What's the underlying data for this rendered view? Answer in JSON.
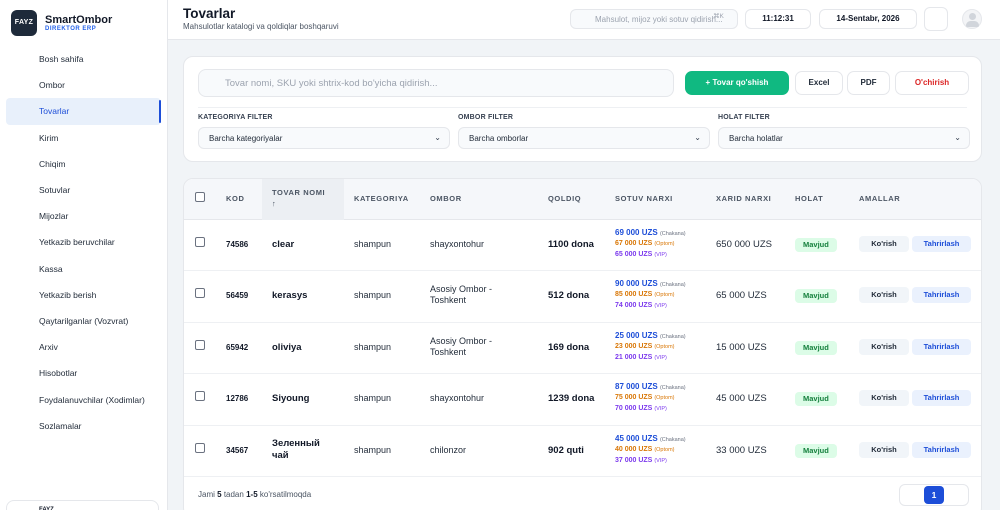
{
  "brand": {
    "logo": "FAYZ",
    "name": "SmartOmbor",
    "subtitle": "DIREKTOR ERP"
  },
  "sidebar": {
    "items": [
      {
        "label": "Bosh sahifa"
      },
      {
        "label": "Ombor"
      },
      {
        "label": "Tovarlar",
        "active": true
      },
      {
        "label": "Kirim"
      },
      {
        "label": "Chiqim"
      },
      {
        "label": "Sotuvlar"
      },
      {
        "label": "Mijozlar"
      },
      {
        "label": "Yetkazib beruvchilar"
      },
      {
        "label": "Kassa"
      },
      {
        "label": "Yetkazib berish"
      },
      {
        "label": "Qaytarilganlar (Vozvrat)"
      },
      {
        "label": "Arxiv"
      },
      {
        "label": "Hisobotlar"
      },
      {
        "label": "Foydalanuvchilar (Xodimlar)"
      },
      {
        "label": "Sozlamalar"
      }
    ],
    "user_card": "FAYZ"
  },
  "header": {
    "title": "Tovarlar",
    "subtitle": "Mahsulotlar katalogi va qoldiqlar boshqaruvi",
    "search_placeholder": "Mahsulot, mijoz yoki sotuv qidirish...",
    "shortcut": "⌘K",
    "clock": "11:12:31",
    "date": "14-Sentabr, 2026"
  },
  "toolbar": {
    "search_placeholder": "Tovar nomi, SKU yoki shtrix-kod bo'yicha qidirish...",
    "add_label": "+ Tovar qo'shish",
    "excel_label": "Excel",
    "pdf_label": "PDF",
    "delete_label": "O'chirish"
  },
  "filters": {
    "category": {
      "label": "KATEGORIYA FILTER",
      "value": "Barcha kategoriyalar"
    },
    "warehouse": {
      "label": "OMBOR FILTER",
      "value": "Barcha omborlar"
    },
    "status": {
      "label": "HOLAT FILTER",
      "value": "Barcha holatlar"
    }
  },
  "table": {
    "columns": {
      "kod": "KOD",
      "name": "TOVAR NOMI",
      "name_sort": "↑",
      "category": "KATEGORIYA",
      "warehouse": "OMBOR",
      "stock": "QOLDIQ",
      "sell_price": "SOTUV NARXI",
      "buy_price": "XARID NARXI",
      "status": "HOLAT",
      "actions": "AMALLAR"
    },
    "price_tags": {
      "retail": "(Chakana)",
      "wholesale": "(Optom)",
      "vip": "(VIP)"
    },
    "view_label": "Ko'rish",
    "edit_label": "Tahrirlash",
    "rows": [
      {
        "kod": "74586",
        "name": "clear",
        "category": "shampun",
        "warehouse": "shayxontohur",
        "stock": "1100 dona",
        "retail": "69 000 UZS",
        "wholesale": "67 000 UZS",
        "vip": "65 000 UZS",
        "buy": "650 000 UZS",
        "status": "Mavjud"
      },
      {
        "kod": "56459",
        "name": "kerasys",
        "category": "shampun",
        "warehouse": "Asosiy Ombor - Toshkent",
        "stock": "512 dona",
        "retail": "90 000 UZS",
        "wholesale": "85 000 UZS",
        "vip": "74 000 UZS",
        "buy": "65 000 UZS",
        "status": "Mavjud"
      },
      {
        "kod": "65942",
        "name": "oliviya",
        "category": "shampun",
        "warehouse": "Asosiy Ombor - Toshkent",
        "stock": "169 dona",
        "retail": "25 000 UZS",
        "wholesale": "23 000 UZS",
        "vip": "21 000 UZS",
        "buy": "15 000 UZS",
        "status": "Mavjud"
      },
      {
        "kod": "12786",
        "name": "Siyoung",
        "category": "shampun",
        "warehouse": "shayxontohur",
        "stock": "1239 dona",
        "retail": "87 000 UZS",
        "wholesale": "75 000 UZS",
        "vip": "70 000 UZS",
        "buy": "45 000 UZS",
        "status": "Mavjud"
      },
      {
        "kod": "34567",
        "name": "Зеленный чай",
        "category": "shampun",
        "warehouse": "chilonzor",
        "stock": "902 quti",
        "retail": "45 000 UZS",
        "wholesale": "40 000 UZS",
        "vip": "37 000 UZS",
        "buy": "33 000 UZS",
        "status": "Mavjud"
      }
    ]
  },
  "footer": {
    "prefix": "Jami",
    "total": "5",
    "mid": "tadan",
    "range": "1-5",
    "suffix": "ko'rsatilmoqda",
    "current_page": "1"
  }
}
